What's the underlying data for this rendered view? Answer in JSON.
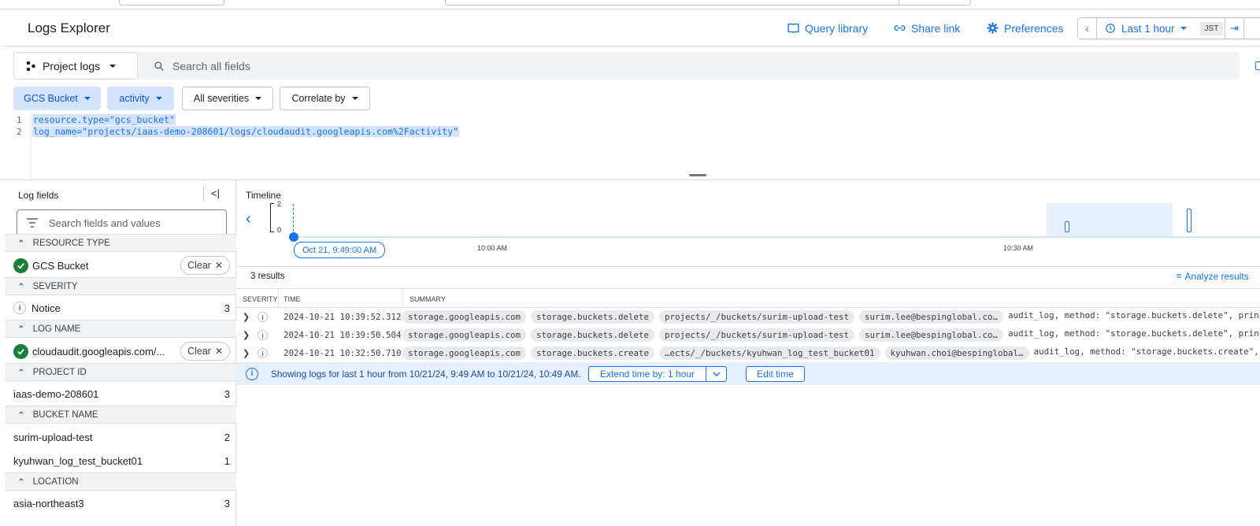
{
  "header": {
    "title": "Logs Explorer",
    "query_library": "Query library",
    "share_link": "Share link",
    "preferences": "Preferences",
    "time_range": "Last 1 hour",
    "timezone": "JST"
  },
  "query": {
    "scope_label": "Project logs",
    "search_placeholder": "Search all fields",
    "chips": [
      "GCS Bucket",
      "activity",
      "All severities",
      "Correlate by"
    ],
    "lines": [
      {
        "num": "1",
        "text": "resource.type=\"gcs_bucket\""
      },
      {
        "num": "2",
        "text": "log_name=\"projects/iaas-demo-208601/logs/cloudaudit.googleapis.com%2Factivity\""
      }
    ]
  },
  "log_fields": {
    "title": "Log fields",
    "search_placeholder": "Search fields and values",
    "clear_label": "Clear",
    "sections": {
      "resource_type": "RESOURCE TYPE",
      "severity": "SEVERITY",
      "log_name": "LOG NAME",
      "project_id": "PROJECT ID",
      "bucket_name": "BUCKET NAME",
      "location": "LOCATION"
    },
    "values": {
      "resource_type": {
        "label": "GCS Bucket"
      },
      "severity": {
        "label": "Notice",
        "count": "3"
      },
      "log_name": {
        "label": "cloudaudit.googleapis.com/..."
      },
      "project_id": {
        "label": "iaas-demo-208601",
        "count": "3"
      },
      "bucket_1": {
        "label": "surim-upload-test",
        "count": "2"
      },
      "bucket_2": {
        "label": "kyuhwan_log_test_bucket01",
        "count": "1"
      },
      "location": {
        "label": "asia-northeast3",
        "count": "3"
      }
    }
  },
  "timeline": {
    "title": "Timeline",
    "y_max": "2",
    "y_min": "0",
    "start_label": "Oct 21, 9:49:00 AM",
    "tick_1": "10:00 AM",
    "tick_2": "10:30 AM"
  },
  "results": {
    "count_label": "3 results",
    "analyze_label": "Analyze results",
    "columns": {
      "severity": "SEVERITY",
      "time": "TIME",
      "summary": "SUMMARY"
    },
    "rows": [
      {
        "time": "2024-10-21 10:39:52.312",
        "chips": [
          "storage.googleapis.com",
          "storage.buckets.delete",
          "projects/_/buckets/surim-upload-test",
          "surim.lee@bespinglobal.co…"
        ],
        "msg": "audit_log, method: \"storage.buckets.delete\", principa"
      },
      {
        "time": "2024-10-21 10:39:50.504",
        "chips": [
          "storage.googleapis.com",
          "storage.buckets.delete",
          "projects/_/buckets/surim-upload-test",
          "surim.lee@bespinglobal.co…"
        ],
        "msg": "audit_log, method: \"storage.buckets.delete\", principa"
      },
      {
        "time": "2024-10-21 10:32:50.710",
        "chips": [
          "storage.googleapis.com",
          "storage.buckets.create",
          "…ects/_/buckets/kyuhwan_log_test_bucket01",
          "kyuhwan.choi@bespinglobal…"
        ],
        "msg": "audit_log, method: \"storage.buckets.create\", pri"
      }
    ],
    "banner_text": "Showing logs for last 1 hour from 10/21/24, 9:49 AM to 10/21/24, 10:49 AM.",
    "extend_label": "Extend time by: 1 hour",
    "edit_time_label": "Edit time"
  },
  "colors": {
    "accent": "#1a73e8",
    "chip_active_bg": "#d3e3fd",
    "success": "#188038"
  }
}
